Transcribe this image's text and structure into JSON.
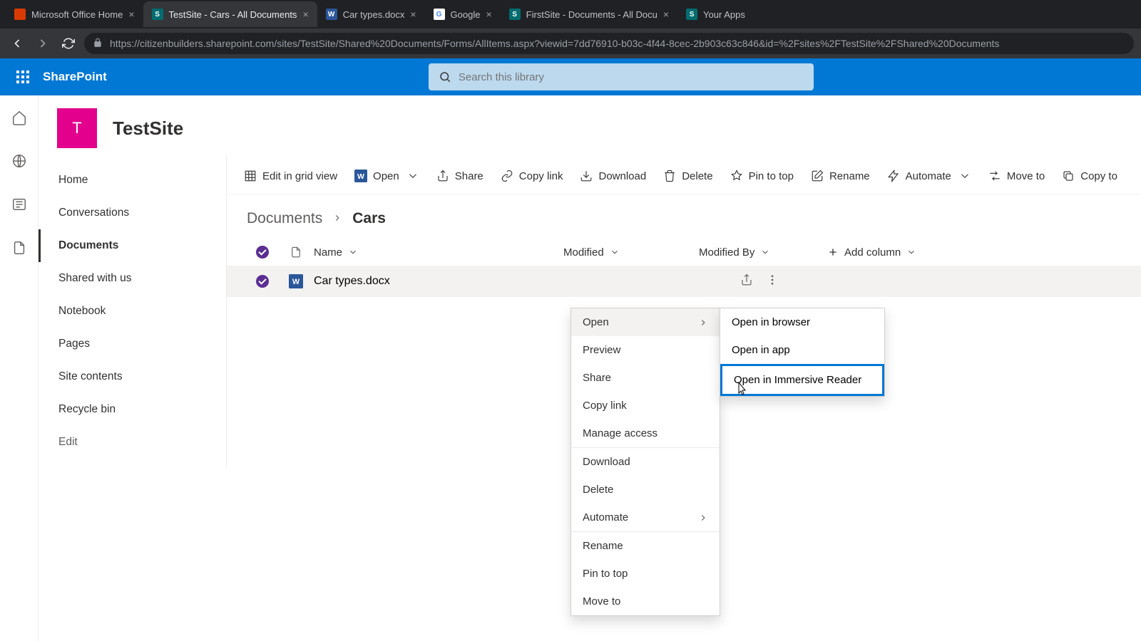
{
  "browser": {
    "tabs": [
      {
        "label": "Microsoft Office Home",
        "favicon_bg": "#d83b01",
        "favicon_text": ""
      },
      {
        "label": "TestSite - Cars - All Documents",
        "favicon_bg": "#036c70",
        "favicon_text": "S",
        "active": true
      },
      {
        "label": "Car types.docx",
        "favicon_bg": "#2b579a",
        "favicon_text": "W"
      },
      {
        "label": "Google",
        "favicon_bg": "#ffffff",
        "favicon_text": "G"
      },
      {
        "label": "FirstSite - Documents - All Docu",
        "favicon_bg": "#036c70",
        "favicon_text": "S"
      },
      {
        "label": "Your Apps",
        "favicon_bg": "#036c70",
        "favicon_text": "S"
      }
    ],
    "url": "https://citizenbuilders.sharepoint.com/sites/TestSite/Shared%20Documents/Forms/AllItems.aspx?viewid=7dd76910-b03c-4f44-8cec-2b903c63c846&id=%2Fsites%2FTestSite%2FShared%20Documents"
  },
  "suite": {
    "brand": "SharePoint",
    "search_placeholder": "Search this library"
  },
  "site": {
    "logo_letter": "T",
    "title": "TestSite"
  },
  "left_nav": {
    "items": [
      "Home",
      "Conversations",
      "Documents",
      "Shared with us",
      "Notebook",
      "Pages",
      "Site contents",
      "Recycle bin"
    ],
    "selected_index": 2,
    "edit_label": "Edit"
  },
  "cmd_bar": {
    "edit_grid": "Edit in grid view",
    "open": "Open",
    "share": "Share",
    "copy_link": "Copy link",
    "download": "Download",
    "delete": "Delete",
    "pin": "Pin to top",
    "rename": "Rename",
    "automate": "Automate",
    "move": "Move to",
    "copy_to": "Copy to"
  },
  "breadcrumb": {
    "parent": "Documents",
    "current": "Cars"
  },
  "columns": {
    "name": "Name",
    "modified": "Modified",
    "modified_by": "Modified By",
    "add": "Add column"
  },
  "row": {
    "file_name": "Car types.docx"
  },
  "context_menu": {
    "open": "Open",
    "preview": "Preview",
    "share": "Share",
    "copy_link": "Copy link",
    "manage_access": "Manage access",
    "download": "Download",
    "delete": "Delete",
    "automate": "Automate",
    "rename": "Rename",
    "pin": "Pin to top",
    "move": "Move to"
  },
  "submenu": {
    "browser": "Open in browser",
    "app": "Open in app",
    "immersive": "Open in Immersive Reader"
  }
}
